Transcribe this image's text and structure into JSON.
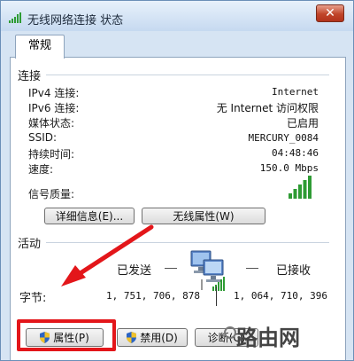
{
  "window": {
    "title": "无线网络连接 状态",
    "close_glyph": "✕"
  },
  "tabs": [
    {
      "label": "常规"
    }
  ],
  "connection": {
    "section_label": "连接",
    "rows": [
      {
        "label": "IPv4 连接:",
        "value": "Internet"
      },
      {
        "label": "IPv6 连接:",
        "value": "无 Internet 访问权限"
      },
      {
        "label": "媒体状态:",
        "value": "已启用"
      },
      {
        "label": "SSID:",
        "value": "MERCURY_0084"
      },
      {
        "label": "持续时间:",
        "value": "04:48:46"
      },
      {
        "label": "速度:",
        "value": "150.0 Mbps"
      }
    ],
    "signal_label": "信号质量:",
    "signal_level": {
      "bars_filled": 5,
      "bars_total": 5
    },
    "details_button": "详细信息(E)...",
    "wireless_props_button": "无线属性(W)"
  },
  "activity": {
    "section_label": "活动",
    "sent_label": "已发送",
    "received_label": "已接收",
    "bytes_label": "字节:",
    "bytes_sent": "1, 751, 706, 878",
    "bytes_received": "1, 064, 710, 396"
  },
  "buttons": {
    "properties": "属性(P)",
    "disable": "禁用(D)",
    "diagnose": "诊断(G)"
  },
  "watermark": {
    "text": "路由网"
  },
  "colors": {
    "highlight": "#e3161a",
    "signal_green": "#2e9b34",
    "window_frame": "#d6e4f3"
  }
}
